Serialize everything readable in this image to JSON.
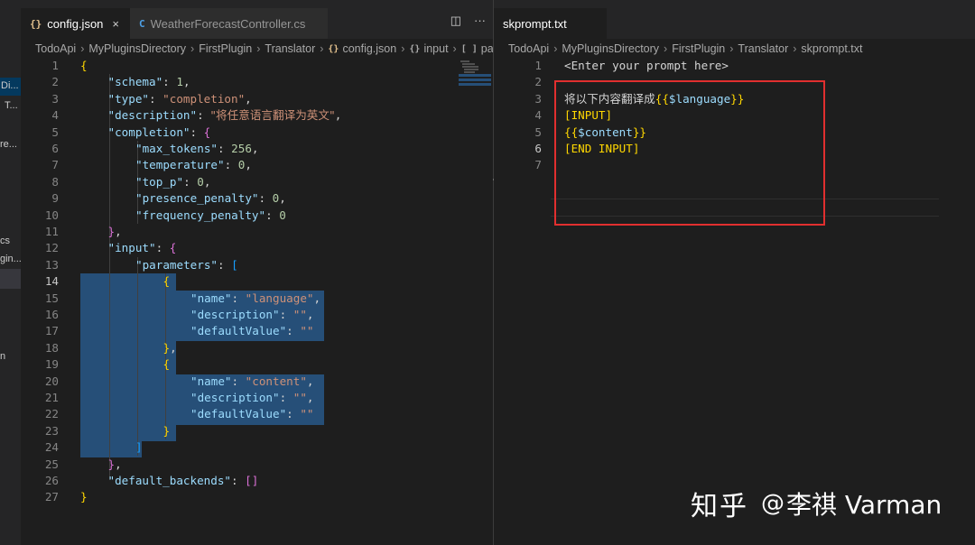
{
  "sidebar": {
    "fragments": [
      "Di...",
      "T...",
      "re...",
      "cs",
      "gin...",
      "n"
    ]
  },
  "left_editor": {
    "tabs": [
      {
        "icon": "{}",
        "label": "config.json",
        "close": "×",
        "active": true
      },
      {
        "icon": "C",
        "label": "WeatherForecastController.cs",
        "active": false
      }
    ],
    "actions": [
      "split-editor",
      "more"
    ],
    "action_glyphs": [
      "◫",
      "···"
    ],
    "breadcrumb": [
      "TodoApi",
      "MyPluginsDirectory",
      "FirstPlugin",
      "Translator",
      "config.json",
      "input",
      "pa"
    ],
    "breadcrumb_icons": {
      "file": "{}",
      "object": "{}",
      "array": "[ ]"
    },
    "current_line": 14,
    "lines": [
      {
        "n": 1,
        "indent": 0,
        "tokens": [
          {
            "t": "{",
            "c": "t-brace"
          }
        ]
      },
      {
        "n": 2,
        "indent": 1,
        "tokens": [
          {
            "t": "\"schema\"",
            "c": "t-key"
          },
          {
            "t": ": ",
            "c": "t-punc"
          },
          {
            "t": "1",
            "c": "t-num"
          },
          {
            "t": ",",
            "c": "t-punc"
          }
        ]
      },
      {
        "n": 3,
        "indent": 1,
        "tokens": [
          {
            "t": "\"type\"",
            "c": "t-key"
          },
          {
            "t": ": ",
            "c": "t-punc"
          },
          {
            "t": "\"completion\"",
            "c": "t-str"
          },
          {
            "t": ",",
            "c": "t-punc"
          }
        ]
      },
      {
        "n": 4,
        "indent": 1,
        "tokens": [
          {
            "t": "\"description\"",
            "c": "t-key"
          },
          {
            "t": ": ",
            "c": "t-punc"
          },
          {
            "t": "\"将任意语言翻译为英文\"",
            "c": "t-str t-cn"
          },
          {
            "t": ",",
            "c": "t-punc"
          }
        ]
      },
      {
        "n": 5,
        "indent": 1,
        "tokens": [
          {
            "t": "\"completion\"",
            "c": "t-key"
          },
          {
            "t": ": ",
            "c": "t-punc"
          },
          {
            "t": "{",
            "c": "t-brace2"
          }
        ]
      },
      {
        "n": 6,
        "indent": 2,
        "tokens": [
          {
            "t": "\"max_tokens\"",
            "c": "t-key"
          },
          {
            "t": ": ",
            "c": "t-punc"
          },
          {
            "t": "256",
            "c": "t-num"
          },
          {
            "t": ",",
            "c": "t-punc"
          }
        ]
      },
      {
        "n": 7,
        "indent": 2,
        "tokens": [
          {
            "t": "\"temperature\"",
            "c": "t-key"
          },
          {
            "t": ": ",
            "c": "t-punc"
          },
          {
            "t": "0",
            "c": "t-num"
          },
          {
            "t": ",",
            "c": "t-punc"
          }
        ]
      },
      {
        "n": 8,
        "indent": 2,
        "tokens": [
          {
            "t": "\"top_p\"",
            "c": "t-key"
          },
          {
            "t": ": ",
            "c": "t-punc"
          },
          {
            "t": "0",
            "c": "t-num"
          },
          {
            "t": ",",
            "c": "t-punc"
          }
        ]
      },
      {
        "n": 9,
        "indent": 2,
        "tokens": [
          {
            "t": "\"presence_penalty\"",
            "c": "t-key"
          },
          {
            "t": ": ",
            "c": "t-punc"
          },
          {
            "t": "0",
            "c": "t-num"
          },
          {
            "t": ",",
            "c": "t-punc"
          }
        ]
      },
      {
        "n": 10,
        "indent": 2,
        "tokens": [
          {
            "t": "\"frequency_penalty\"",
            "c": "t-key"
          },
          {
            "t": ": ",
            "c": "t-punc"
          },
          {
            "t": "0",
            "c": "t-num"
          }
        ]
      },
      {
        "n": 11,
        "indent": 1,
        "tokens": [
          {
            "t": "}",
            "c": "t-brace2"
          },
          {
            "t": ",",
            "c": "t-punc"
          }
        ]
      },
      {
        "n": 12,
        "indent": 1,
        "tokens": [
          {
            "t": "\"input\"",
            "c": "t-key"
          },
          {
            "t": ": ",
            "c": "t-punc"
          },
          {
            "t": "{",
            "c": "t-brace2"
          }
        ]
      },
      {
        "n": 13,
        "indent": 2,
        "tokens": [
          {
            "t": "\"parameters\"",
            "c": "t-key"
          },
          {
            "t": ": ",
            "c": "t-punc"
          },
          {
            "t": "[",
            "c": "t-brace3"
          }
        ]
      },
      {
        "n": 14,
        "indent": 3,
        "tokens": [
          {
            "t": "{",
            "c": "t-brace"
          }
        ]
      },
      {
        "n": 15,
        "indent": 4,
        "tokens": [
          {
            "t": "\"name\"",
            "c": "t-key"
          },
          {
            "t": ": ",
            "c": "t-punc"
          },
          {
            "t": "\"language\"",
            "c": "t-str"
          },
          {
            "t": ",",
            "c": "t-punc"
          }
        ]
      },
      {
        "n": 16,
        "indent": 4,
        "tokens": [
          {
            "t": "\"description\"",
            "c": "t-key"
          },
          {
            "t": ": ",
            "c": "t-punc"
          },
          {
            "t": "\"\"",
            "c": "t-str"
          },
          {
            "t": ",",
            "c": "t-punc"
          }
        ]
      },
      {
        "n": 17,
        "indent": 4,
        "tokens": [
          {
            "t": "\"defaultValue\"",
            "c": "t-key"
          },
          {
            "t": ": ",
            "c": "t-punc"
          },
          {
            "t": "\"\"",
            "c": "t-str"
          }
        ]
      },
      {
        "n": 18,
        "indent": 3,
        "tokens": [
          {
            "t": "}",
            "c": "t-brace"
          },
          {
            "t": ",",
            "c": "t-punc"
          }
        ]
      },
      {
        "n": 19,
        "indent": 3,
        "tokens": [
          {
            "t": "{",
            "c": "t-brace"
          }
        ]
      },
      {
        "n": 20,
        "indent": 4,
        "tokens": [
          {
            "t": "\"name\"",
            "c": "t-key"
          },
          {
            "t": ": ",
            "c": "t-punc"
          },
          {
            "t": "\"content\"",
            "c": "t-str"
          },
          {
            "t": ",",
            "c": "t-punc"
          }
        ]
      },
      {
        "n": 21,
        "indent": 4,
        "tokens": [
          {
            "t": "\"description\"",
            "c": "t-key"
          },
          {
            "t": ": ",
            "c": "t-punc"
          },
          {
            "t": "\"\"",
            "c": "t-str"
          },
          {
            "t": ",",
            "c": "t-punc"
          }
        ]
      },
      {
        "n": 22,
        "indent": 4,
        "tokens": [
          {
            "t": "\"defaultValue\"",
            "c": "t-key"
          },
          {
            "t": ": ",
            "c": "t-punc"
          },
          {
            "t": "\"\"",
            "c": "t-str"
          }
        ]
      },
      {
        "n": 23,
        "indent": 3,
        "tokens": [
          {
            "t": "}",
            "c": "t-brace"
          }
        ]
      },
      {
        "n": 24,
        "indent": 2,
        "tokens": [
          {
            "t": "]",
            "c": "t-brace3"
          }
        ]
      },
      {
        "n": 25,
        "indent": 1,
        "tokens": [
          {
            "t": "}",
            "c": "t-brace2"
          },
          {
            "t": ",",
            "c": "t-punc"
          }
        ]
      },
      {
        "n": 26,
        "indent": 1,
        "tokens": [
          {
            "t": "\"default_backends\"",
            "c": "t-key"
          },
          {
            "t": ": ",
            "c": "t-punc"
          },
          {
            "t": "[]",
            "c": "t-brace2"
          }
        ]
      },
      {
        "n": 27,
        "indent": 0,
        "tokens": [
          {
            "t": "}",
            "c": "t-brace"
          }
        ]
      }
    ]
  },
  "right_editor": {
    "tabs": [
      {
        "label": "skprompt.txt",
        "active": true
      }
    ],
    "breadcrumb": [
      "TodoApi",
      "MyPluginsDirectory",
      "FirstPlugin",
      "Translator",
      "skprompt.txt"
    ],
    "current_line": 6,
    "lines": [
      {
        "n": 1,
        "tokens": [
          {
            "t": "<Enter your prompt here>",
            "c": "t-punc"
          }
        ]
      },
      {
        "n": 2,
        "tokens": []
      },
      {
        "n": 3,
        "tokens": [
          {
            "t": "将以下内容翻译成",
            "c": "t-punc t-cn"
          },
          {
            "t": "{{",
            "c": "t-brace"
          },
          {
            "t": "$language",
            "c": "t-key"
          },
          {
            "t": "}}",
            "c": "t-brace"
          }
        ]
      },
      {
        "n": 4,
        "tokens": [
          {
            "t": "[INPUT]",
            "c": "t-brace"
          }
        ]
      },
      {
        "n": 5,
        "tokens": [
          {
            "t": "{{",
            "c": "t-brace"
          },
          {
            "t": "$content",
            "c": "t-key"
          },
          {
            "t": "}}",
            "c": "t-brace"
          }
        ]
      },
      {
        "n": 6,
        "tokens": [
          {
            "t": "[END INPUT]",
            "c": "t-brace"
          }
        ]
      },
      {
        "n": 7,
        "tokens": []
      }
    ]
  },
  "watermark": {
    "site": "知乎",
    "at": "@",
    "author": "李祺 Varman"
  },
  "colors": {
    "annotation": "#e12f2f",
    "selection": "#264f78",
    "background": "#1e1e1e"
  }
}
